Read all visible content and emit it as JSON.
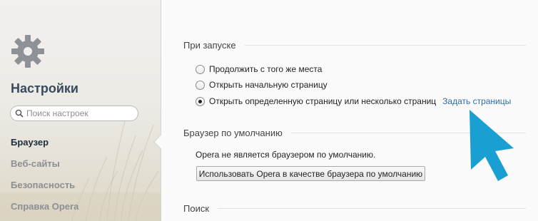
{
  "sidebar": {
    "title": "Настройки",
    "search_placeholder": "Поиск настроек",
    "items": [
      {
        "label": "Браузер",
        "active": true
      },
      {
        "label": "Веб-сайты",
        "active": false
      },
      {
        "label": "Безопасность",
        "active": false
      },
      {
        "label": "Справка Opera",
        "active": false
      }
    ]
  },
  "startup": {
    "title": "При запуске",
    "options": [
      {
        "label": "Продолжить с того же места",
        "checked": false
      },
      {
        "label": "Открыть начальную страницу",
        "checked": false
      },
      {
        "label": "Открыть определенную страницу или несколько страниц",
        "checked": true
      }
    ],
    "set_pages_link": "Задать страницы"
  },
  "default_browser": {
    "title": "Браузер по умолчанию",
    "status": "Opera не является браузером по умолчанию.",
    "button": "Использовать Opera в качестве браузера по умолчанию"
  },
  "search": {
    "title": "Поиск"
  },
  "colors": {
    "accent_arrow": "#1a9fd2",
    "link": "#2d6ca8"
  },
  "icons": {
    "gear": "gear-icon",
    "search": "search-icon",
    "pointer": "pointer-arrow-icon"
  }
}
